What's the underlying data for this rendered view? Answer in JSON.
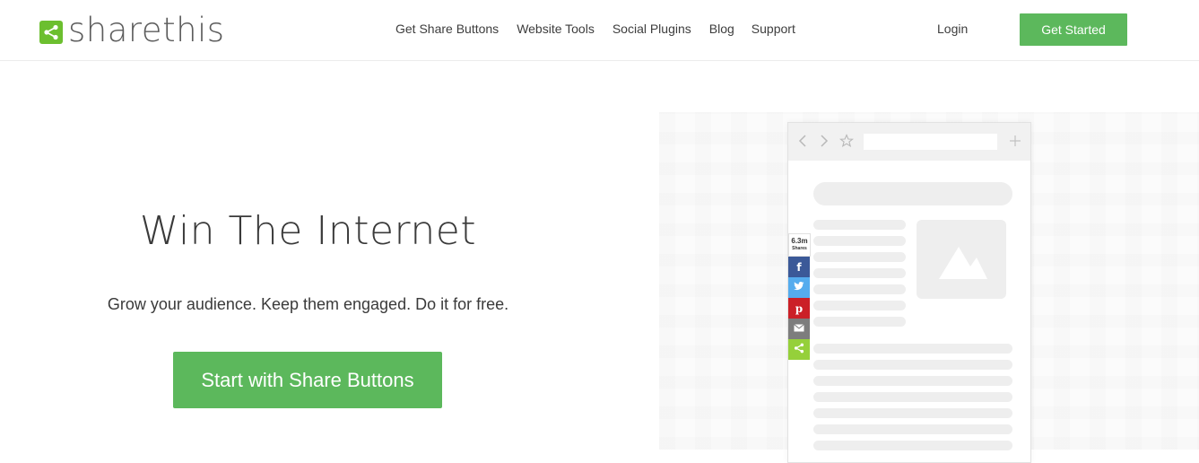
{
  "brand": {
    "name": "sharethis",
    "accent": "#6cbf2f"
  },
  "nav": {
    "items": [
      "Get Share Buttons",
      "Website Tools",
      "Social Plugins",
      "Blog",
      "Support"
    ],
    "login": "Login",
    "cta": "Get Started"
  },
  "hero": {
    "title": "Win The Internet",
    "subtitle": "Grow your audience. Keep them engaged. Do it for free.",
    "cta": "Start with Share Buttons"
  },
  "illustration": {
    "toolbar_icons": [
      "chevron-left-icon",
      "chevron-right-icon",
      "star-icon",
      "plus-icon"
    ],
    "share_count": {
      "value": "6.3m",
      "label": "Shares"
    },
    "share_buttons": [
      {
        "name": "facebook-icon",
        "glyph": "f",
        "color": "#3b5998"
      },
      {
        "name": "twitter-icon",
        "glyph": "t",
        "color": "#55acee"
      },
      {
        "name": "pinterest-icon",
        "glyph": "p",
        "color": "#cb2027"
      },
      {
        "name": "email-icon",
        "glyph": "✉",
        "color": "#7d7d7d"
      },
      {
        "name": "sharethis-icon",
        "glyph": "<",
        "color": "#95d03a"
      }
    ]
  },
  "colors": {
    "button_green": "#5cb85c",
    "text": "#3a3a3a"
  }
}
